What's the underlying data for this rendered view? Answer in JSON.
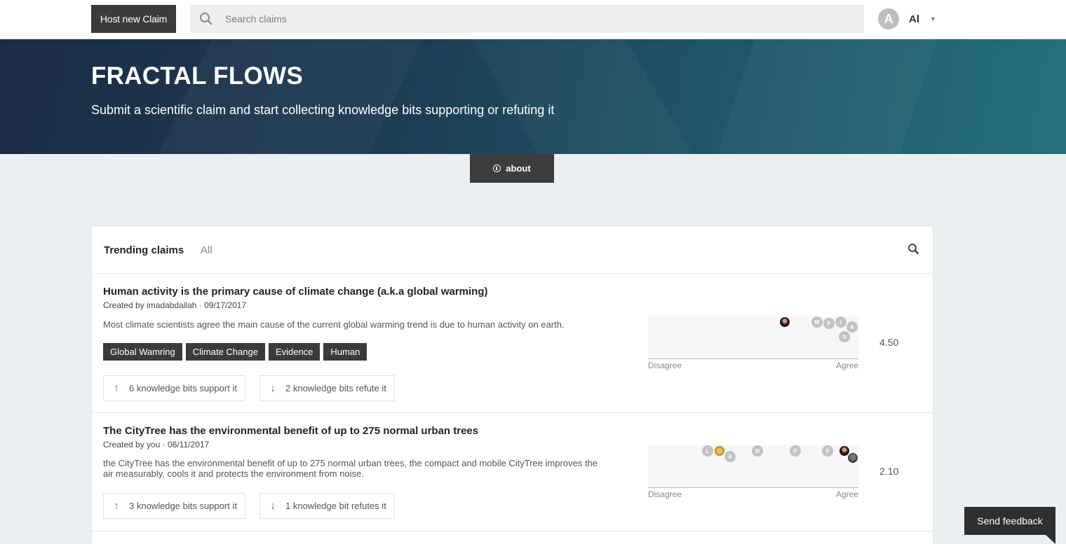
{
  "header": {
    "host_button": "Host new Claim",
    "search_placeholder": "Search claims",
    "user_initial": "A",
    "user_name": "Al"
  },
  "hero": {
    "title": "FRACTAL FLOWS",
    "subtitle": "Submit a scientific claim and start collecting knowledge bits supporting or refuting it"
  },
  "about_label": "about",
  "tabs": {
    "trending": "Trending claims",
    "all": "All"
  },
  "claims": [
    {
      "title": "Human activity is the primary cause of climate change (a.k.a global warming)",
      "meta": "Created by imadabdallah · 09/17/2017",
      "description": "Most climate scientists agree the main cause of the current global warming trend is due to human activity on earth.",
      "tags": [
        "Global Wamring",
        "Climate Change",
        "Evidence",
        "Human"
      ],
      "support": "6 knowledge bits support it",
      "refute": "2 knowledge bits refute it",
      "score": "4.50",
      "disagree": "Disagree",
      "agree": "Agree",
      "voters": [
        "",
        "M",
        "P",
        "I",
        "A",
        "S"
      ]
    },
    {
      "title": "The CityTree has the environmental benefit of up to 275 normal urban trees",
      "meta": "Created by you · 06/11/2017",
      "description": "the CityTree has the environmental benefit of up to 275 normal urban trees, the compact and mobile CityTree improves the air measurably, cools it and protects the environment from noise.",
      "tags": [],
      "support": "3 knowledge bits support it",
      "refute": "1 knowledge bit refutes it",
      "score": "2.10",
      "disagree": "Disagree",
      "agree": "Agree",
      "voters": [
        "L",
        "",
        "A",
        "M",
        "P",
        "P",
        "",
        ""
      ]
    }
  ],
  "feedback_label": "Send feedback",
  "colors": {
    "dark_button": "#3b3b3b",
    "hero_start": "#1b2d44",
    "hero_end": "#26707c",
    "page_bg": "#eceff1",
    "support_arrow": "#3c9a3c",
    "refute_arrow": "#c0392b"
  },
  "icons": {
    "search": "search-icon",
    "info": "info-icon",
    "caret": "caret-down-icon",
    "up": "arrow-up-icon",
    "down": "arrow-down-icon"
  }
}
